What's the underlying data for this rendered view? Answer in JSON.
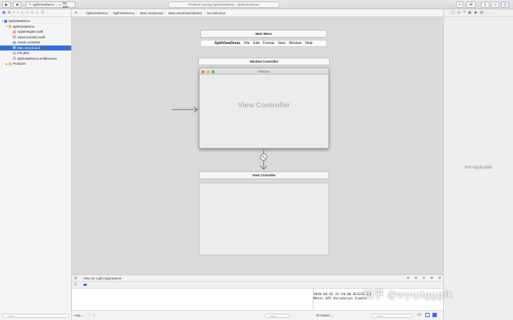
{
  "toolbar": {
    "scheme_name": "SplitViewDemo",
    "destination": "My Mac",
    "activity_status": "Finished running SplitViewDemo : SplitViewDemo"
  },
  "navigator": {
    "items": [
      {
        "label": "SplitViewDemo",
        "level": 0,
        "icon": "project",
        "expanded": true
      },
      {
        "label": "SplitViewDemo",
        "level": 1,
        "icon": "folder",
        "expanded": true
      },
      {
        "label": "AppDelegate.swift",
        "level": 2,
        "icon": "swift"
      },
      {
        "label": "ViewController.swift",
        "level": 2,
        "icon": "swift"
      },
      {
        "label": "Assets.xcassets",
        "level": 2,
        "icon": "asset"
      },
      {
        "label": "Main.storyboard",
        "level": 2,
        "icon": "storyboard",
        "selected": true
      },
      {
        "label": "Info.plist",
        "level": 2,
        "icon": "plist"
      },
      {
        "label": "SplitViewDemo.entitlements",
        "level": 2,
        "icon": "plist"
      },
      {
        "label": "Products",
        "level": 1,
        "icon": "folder",
        "expanded": false
      }
    ],
    "filter_placeholder": "Filter"
  },
  "jumpbar": {
    "crumbs": [
      "SplitViewDemo",
      "SplitViewDemo",
      "Main.storyboard",
      "Main.storyboard (Base)",
      "No Selection"
    ]
  },
  "canvas": {
    "main_menu_title": "Main Menu",
    "menu_items": [
      "SplitViewDemo",
      "File",
      "Edit",
      "Format",
      "View",
      "Window",
      "Help"
    ],
    "window_controller_title": "Window Controller",
    "window_title": "Window",
    "view_controller_placeholder": "View Controller",
    "view_controller_title": "View Controller"
  },
  "debug": {
    "view_as": "View as: Light Appearance",
    "console_lines": [
      "2020-04-02 21:24:00.823228+08",
      "Metal API Validation Enable"
    ],
    "auto_label": "Auto",
    "filter_placeholder": "Filter",
    "output_select": "All Output"
  },
  "inspector": {
    "empty_state": "Not Applicable"
  },
  "watermark": "知乎 @wyqdgggfk",
  "colors": {
    "selection": "#2f6ee8",
    "close": "#ff5f57",
    "minimize": "#febc2e",
    "zoom": "#28c840"
  }
}
